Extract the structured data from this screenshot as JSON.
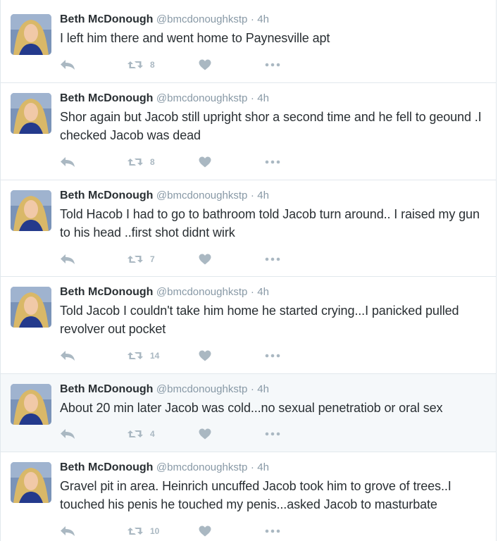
{
  "tweets": [
    {
      "name": "Beth McDonough",
      "handle": "@bmcdonoughkstp",
      "separator": "·",
      "time": "4h",
      "text": "I left him there and went home to Paynesville apt",
      "retweets": "8",
      "highlighted": false
    },
    {
      "name": "Beth McDonough",
      "handle": "@bmcdonoughkstp",
      "separator": "·",
      "time": "4h",
      "text": "Shor again but Jacob still upright shor a second time and he fell to geound .I checked Jacob was dead",
      "retweets": "8",
      "highlighted": false
    },
    {
      "name": "Beth McDonough",
      "handle": "@bmcdonoughkstp",
      "separator": "·",
      "time": "4h",
      "text": "Told Hacob I had to go to bathroom told Jacob turn around.. I raised my gun to his head ..first shot didnt wirk",
      "retweets": "7",
      "highlighted": false
    },
    {
      "name": "Beth McDonough",
      "handle": "@bmcdonoughkstp",
      "separator": "·",
      "time": "4h",
      "text": "Told Jacob I couldn't take him home he started crying...I panicked pulled revolver out pocket",
      "retweets": "14",
      "highlighted": false
    },
    {
      "name": "Beth McDonough",
      "handle": "@bmcdonoughkstp",
      "separator": "·",
      "time": "4h",
      "text": "About 20 min later Jacob was cold...no sexual penetratiob or oral sex",
      "retweets": "4",
      "highlighted": true
    },
    {
      "name": "Beth McDonough",
      "handle": "@bmcdonoughkstp",
      "separator": "·",
      "time": "4h",
      "text": "Gravel pit in area. Heinrich uncuffed Jacob took him to grove of trees..I touched his penis he touched my penis...asked Jacob to masturbate",
      "retweets": "10",
      "highlighted": false
    }
  ],
  "icons": {
    "reply": "reply-icon",
    "retweet": "retweet-icon",
    "like": "heart-icon",
    "more": "more-icon"
  },
  "colors": {
    "text": "#292f33",
    "muted": "#8899a6",
    "icon": "#aab8c2",
    "border": "#e1e8ed",
    "highlight_bg": "#f5f8fa"
  }
}
